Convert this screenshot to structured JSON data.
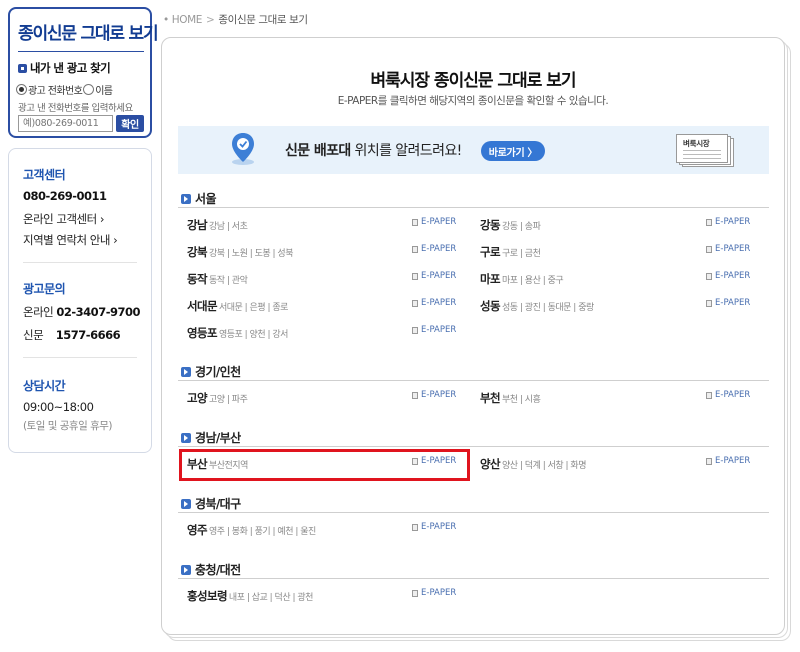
{
  "ad_finder": {
    "title": "종이신문 그대로 보기",
    "subtitle": "내가 낸 광고 찾기",
    "radio_phone": "광고 전화번호",
    "radio_name": "이름",
    "hint": "광고 낸 전화번호를 입력하세요",
    "input_placeholder": "예)080-269-0011",
    "submit_label": "확인"
  },
  "customer_info": {
    "cs_title": "고객센터",
    "cs_phone": "080-269-0011",
    "cs_online": "온라인 고객센터",
    "cs_regional": "지역별 연락처 안내",
    "ad_title": "광고문의",
    "ad_online_label": "온라인",
    "ad_online_phone": "02-3407-9700",
    "ad_paper_label": "신문",
    "ad_paper_phone": "1577-6666",
    "hours_title": "상담시간",
    "hours": "09:00~18:00",
    "hours_note": "(토일 및 공휴일 휴무)"
  },
  "breadcrumb": {
    "home": "HOME",
    "current": "종이신문 그대로 보기"
  },
  "main": {
    "title": "벼룩시장 종이신문 그대로 보기",
    "subtitle": "E-PAPER를 클릭하면 해당지역의 종이신문을 확인할 수 있습니다."
  },
  "banner": {
    "text_bold": "신문 배포대",
    "text_rest": " 위치를 알려드려요!",
    "button_label": "바로가기 〉",
    "paper_title": "벼룩시장"
  },
  "epaper_label": "E-PAPER",
  "sections": [
    {
      "name": "서울",
      "rows": [
        [
          {
            "name": "강남",
            "districts": "강남 | 서초"
          },
          {
            "name": "강동",
            "districts": "강동 | 송파"
          }
        ],
        [
          {
            "name": "강북",
            "districts": "강북 | 노원 | 도봉 | 성북"
          },
          {
            "name": "구로",
            "districts": "구로 | 금천"
          }
        ],
        [
          {
            "name": "동작",
            "districts": "동작 | 관악"
          },
          {
            "name": "마포",
            "districts": "마포 | 용산 | 중구"
          }
        ],
        [
          {
            "name": "서대문",
            "districts": "서대문 | 은평 | 종로"
          },
          {
            "name": "성동",
            "districts": "성동 | 광진 | 동대문 | 중랑"
          }
        ],
        [
          {
            "name": "영등포",
            "districts": "영등포 | 양천 | 강서"
          }
        ]
      ]
    },
    {
      "name": "경기/인천",
      "rows": [
        [
          {
            "name": "고양",
            "districts": "고양 | 파주"
          },
          {
            "name": "부천",
            "districts": "부천 | 시흥"
          }
        ]
      ]
    },
    {
      "name": "경남/부산",
      "rows": [
        [
          {
            "name": "부산",
            "districts": "부산전지역"
          },
          {
            "name": "양산",
            "districts": "양산 | 덕계 | 서창 | 화명"
          }
        ]
      ]
    },
    {
      "name": "경북/대구",
      "rows": [
        [
          {
            "name": "영주",
            "districts": "영주 | 봉화 | 풍기 | 예천 | 울진"
          }
        ]
      ]
    },
    {
      "name": "충청/대전",
      "rows": [
        [
          {
            "name": "홍성보령",
            "districts": "내포 | 삽교 | 덕산 | 광천"
          }
        ]
      ]
    }
  ],
  "colors": {
    "brand_blue": "#2b4ea3",
    "link_blue": "#1f55b0",
    "button_blue": "#3577d4",
    "banner_bg": "#e8f2fb",
    "highlight_red": "#e0141e"
  }
}
